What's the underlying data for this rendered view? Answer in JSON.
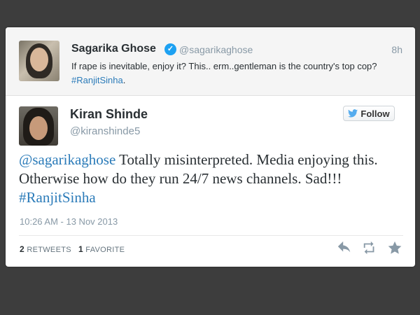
{
  "parent_tweet": {
    "name": "Sagarika Ghose",
    "handle": "@sagarikaghose",
    "time": "8h",
    "text": "If rape is inevitable, enjoy it? This.. erm..gentleman is the country's top cop? ",
    "hashtag": "#RanjitSinha",
    "trailing": "."
  },
  "main_tweet": {
    "name": "Kiran Shinde",
    "handle": "@kiranshinde5",
    "follow_label": "Follow",
    "mention": "@sagarikaghose",
    "text": " Totally misinterpreted. Media enjoying this. Otherwise how do they run 24/7 news channels. Sad!!! ",
    "hashtag": "#RanjitSinha",
    "timestamp": "10:26 AM - 13 Nov 2013",
    "retweets_count": "2",
    "retweets_label": "RETWEETS",
    "favorites_count": "1",
    "favorites_label": "FAVORITE"
  },
  "icons": {
    "verified": "verified-badge-icon",
    "follow": "twitter-bird-icon",
    "reply": "reply-icon",
    "retweet": "retweet-icon",
    "favorite": "star-icon"
  },
  "colors": {
    "link": "#2b7bb9",
    "muted": "#8899a6",
    "verified": "#1da1f2",
    "background": "#3d3d3d"
  }
}
